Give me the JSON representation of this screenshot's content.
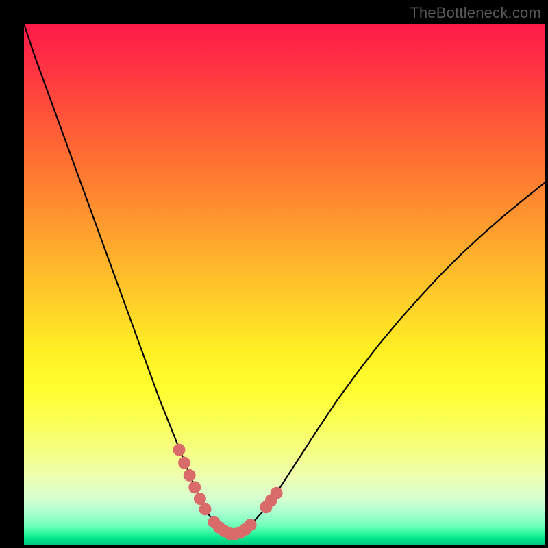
{
  "watermark": "TheBottleneck.com",
  "colors": {
    "background": "#000000",
    "curve": "#000000",
    "marker": "#d96b6b"
  },
  "chart_data": {
    "type": "line",
    "title": "",
    "xlabel": "",
    "ylabel": "",
    "xlim": [
      0,
      100
    ],
    "ylim": [
      0,
      100
    ],
    "grid": false,
    "series": [
      {
        "name": "bottleneck-curve",
        "x": [
          0,
          2,
          4,
          6,
          8,
          10,
          12,
          14,
          16,
          18,
          20,
          22,
          24,
          26,
          28,
          30,
          32,
          34,
          35,
          36,
          37,
          38,
          39,
          40,
          41,
          42,
          44,
          46,
          48,
          50,
          52,
          56,
          60,
          64,
          68,
          72,
          76,
          80,
          84,
          88,
          92,
          96,
          100
        ],
        "values": [
          100,
          94,
          88.5,
          83,
          77.5,
          72,
          66.5,
          61,
          55.5,
          50,
          44.5,
          39,
          33.5,
          28,
          23,
          18,
          13,
          8.5,
          6.5,
          5,
          3.7,
          2.8,
          2.2,
          2,
          2.2,
          2.7,
          4.3,
          6.5,
          9.2,
          12.2,
          15.3,
          21.5,
          27.5,
          33,
          38.2,
          43,
          47.5,
          51.8,
          55.8,
          59.5,
          63,
          66.3,
          69.5
        ]
      }
    ],
    "markers": [
      {
        "name": "optimal-zone-left",
        "x": [
          29.8,
          30.8,
          31.8,
          32.8,
          33.8,
          34.8
        ],
        "values": [
          18.2,
          15.7,
          13.3,
          11.0,
          8.8,
          6.8
        ]
      },
      {
        "name": "optimal-zone-bottom",
        "x": [
          36.5,
          37.5,
          38.5,
          39.5,
          40.5,
          41.5,
          42.5,
          43.5
        ],
        "values": [
          4.3,
          3.3,
          2.6,
          2.1,
          2.0,
          2.3,
          2.9,
          3.8
        ]
      },
      {
        "name": "optimal-zone-right",
        "x": [
          46.5,
          47.5,
          48.5
        ],
        "values": [
          7.2,
          8.5,
          9.9
        ]
      }
    ]
  }
}
